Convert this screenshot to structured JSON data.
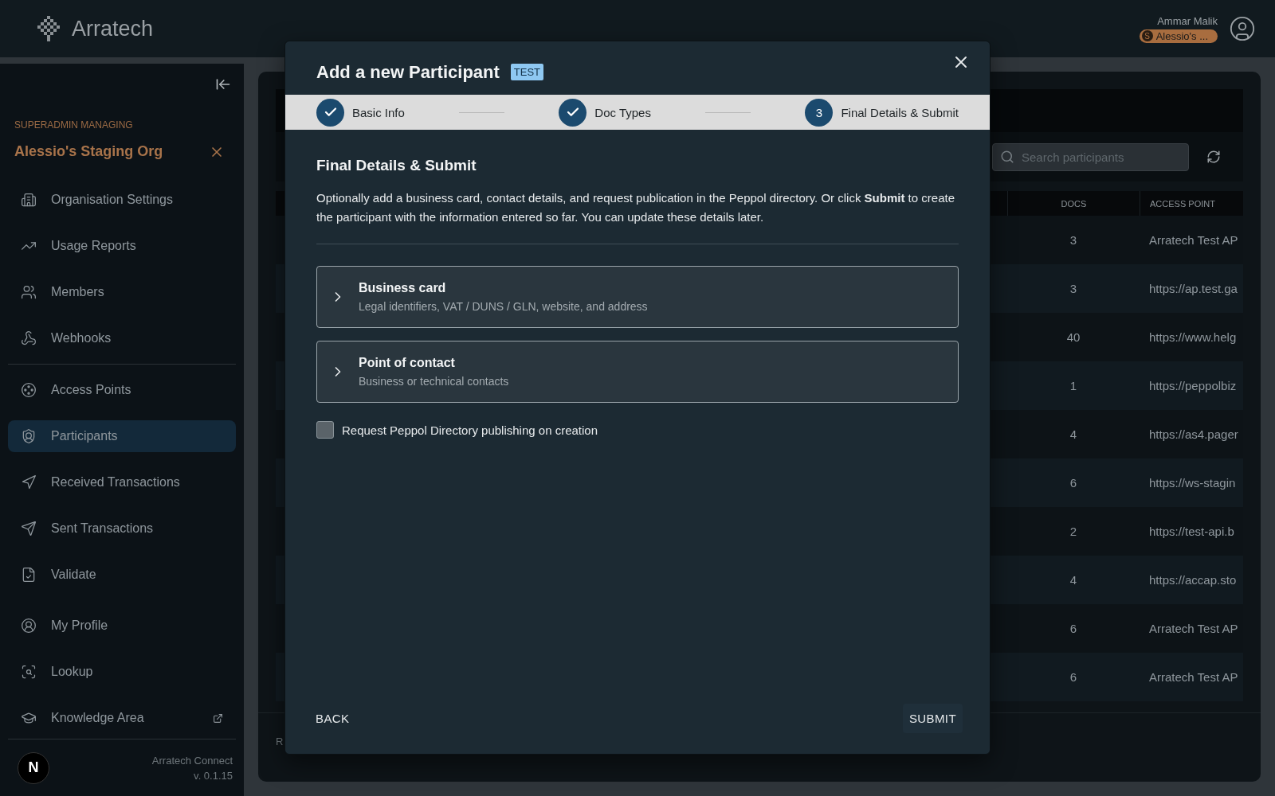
{
  "header": {
    "brand": "Arratech",
    "user_name": "Ammar Malik",
    "org_badge_letter": "S",
    "org_badge": "Alessio's ..."
  },
  "sidebar": {
    "managing_label": "SUPERADMIN MANAGING",
    "org_name": "Alessio's Staging Org",
    "groups": [
      [
        {
          "label": "Organisation Settings",
          "selected": false,
          "external": false
        },
        {
          "label": "Usage Reports",
          "selected": false,
          "external": false
        },
        {
          "label": "Members",
          "selected": false,
          "external": false
        },
        {
          "label": "Webhooks",
          "selected": false,
          "external": false
        }
      ],
      [
        {
          "label": "Access Points",
          "selected": false,
          "external": false
        },
        {
          "label": "Participants",
          "selected": true,
          "external": false
        },
        {
          "label": "Received Transactions",
          "selected": false,
          "external": false
        },
        {
          "label": "Sent Transactions",
          "selected": false,
          "external": false
        },
        {
          "label": "Validate",
          "selected": false,
          "external": false
        }
      ],
      [
        {
          "label": "My Profile",
          "selected": false,
          "external": false
        },
        {
          "label": "Lookup",
          "selected": false,
          "external": false
        },
        {
          "label": "Knowledge Area",
          "selected": false,
          "external": true
        }
      ]
    ],
    "footer": {
      "avatar_letter": "N",
      "app_name": "Arratech Connect",
      "version": "v. 0.1.15"
    }
  },
  "main": {
    "search": {
      "placeholder": "Search participants"
    },
    "table": {
      "columns": [
        "DOCS",
        "ACCESS POINT"
      ],
      "rows": [
        {
          "docs": "3",
          "access_point": "Arratech Test AP"
        },
        {
          "docs": "3",
          "access_point": "https://ap.test.ga"
        },
        {
          "docs": "40",
          "access_point": "https://www.helg"
        },
        {
          "docs": "1",
          "access_point": "https://peppolbiz"
        },
        {
          "docs": "4",
          "access_point": "https://as4.pager"
        },
        {
          "docs": "6",
          "access_point": "https://ws-stagin"
        },
        {
          "docs": "2",
          "access_point": "https://test-api.b"
        },
        {
          "docs": "4",
          "access_point": "https://accap.sto"
        },
        {
          "docs": "6",
          "access_point": "Arratech Test AP"
        },
        {
          "docs": "6",
          "access_point": "Arratech Test AP"
        }
      ]
    },
    "footer_text": "R"
  },
  "modal": {
    "title": "Add a new Participant",
    "badge": "TEST",
    "steps": [
      {
        "label": "Basic Info",
        "completed": true
      },
      {
        "label": "Doc Types",
        "completed": true
      },
      {
        "label": "Final Details & Submit",
        "completed": false,
        "number": "3"
      }
    ],
    "heading": "Final Details & Submit",
    "description": "Optionally add a business card, contact details, and request publication in the Peppol directory. Or click **Submit** to create the participant with the information entered so far. You can update these details later.",
    "sections": [
      {
        "title": "Business card",
        "subtitle": "Legal identifiers, VAT / DUNS / GLN, website, and address",
        "expanded": false
      },
      {
        "title": "Point of contact",
        "subtitle": "Business or technical contacts",
        "expanded": false
      }
    ],
    "checkbox": {
      "label": "Request Peppol Directory publishing on creation",
      "checked": false
    },
    "back_button": "BACK",
    "submit_button": "SUBMIT"
  }
}
